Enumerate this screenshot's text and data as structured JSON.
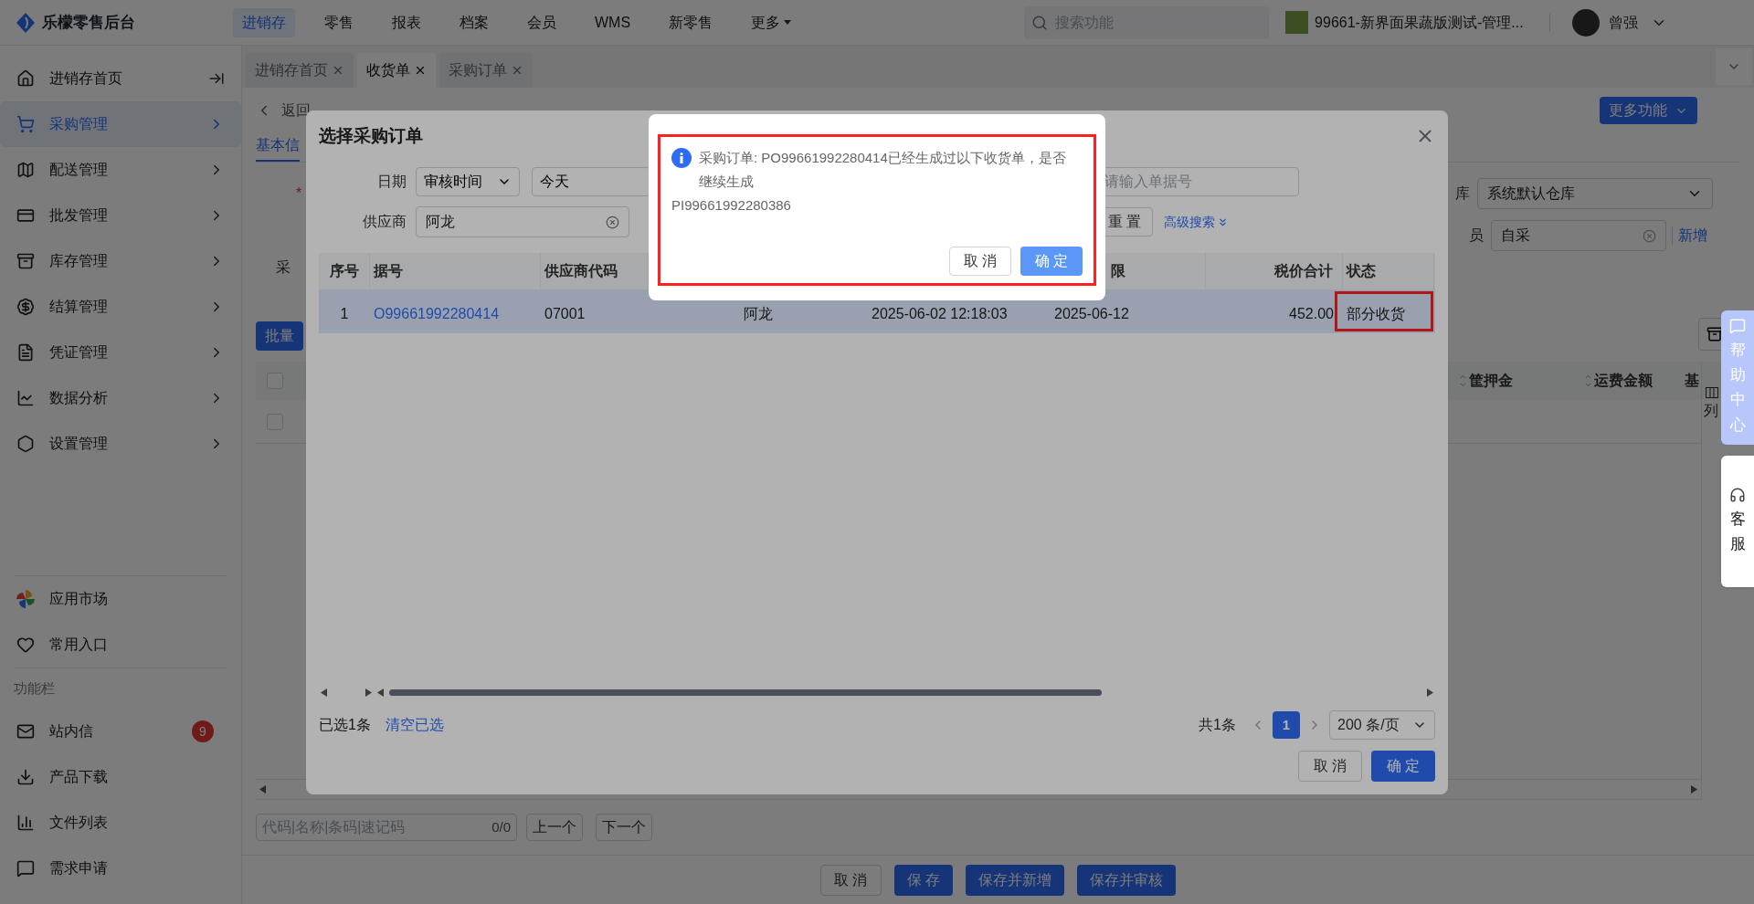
{
  "top_bar": {
    "logo": "乐檬零售后台",
    "nav": [
      {
        "label": "进销存",
        "selected": true,
        "kind": "link"
      },
      {
        "label": "零售",
        "selected": false,
        "kind": "link"
      },
      {
        "label": "报表",
        "selected": false,
        "kind": "link"
      },
      {
        "label": "档案",
        "selected": false,
        "kind": "link"
      },
      {
        "label": "会员",
        "selected": false,
        "kind": "link"
      },
      {
        "label": "WMS",
        "selected": false,
        "kind": "link"
      },
      {
        "label": "新零售",
        "selected": false,
        "kind": "link"
      },
      {
        "label": "更多",
        "selected": false,
        "kind": "dropdown"
      }
    ],
    "search": {
      "placeholder": "搜索功能"
    },
    "store": "99661-新界面果蔬版测试-管理...",
    "user": "曾强"
  },
  "sidebar": {
    "items": [
      {
        "label": "进销存首页",
        "selected": false
      },
      {
        "label": "采购管理",
        "selected": true
      },
      {
        "label": "配送管理",
        "selected": false
      },
      {
        "label": "批发管理",
        "selected": false
      },
      {
        "label": "库存管理",
        "selected": false
      },
      {
        "label": "结算管理",
        "selected": false
      },
      {
        "label": "凭证管理",
        "selected": false
      },
      {
        "label": "数据分析",
        "selected": false
      },
      {
        "label": "设置管理",
        "selected": false
      }
    ],
    "shortcuts": [
      {
        "label": "应用市场"
      },
      {
        "label": "常用入口"
      }
    ],
    "section_title": "功能栏",
    "tools": [
      {
        "label": "站内信",
        "badge": "9"
      },
      {
        "label": "产品下载"
      },
      {
        "label": "文件列表"
      },
      {
        "label": "需求申请"
      }
    ]
  },
  "page_tabs": [
    {
      "label": "进销存首页",
      "selected": false
    },
    {
      "label": "收货单",
      "selected": true
    },
    {
      "label": "采购订单",
      "selected": false
    }
  ],
  "page": {
    "back": "返回",
    "more_button": "更多功能",
    "form_tab": "基本信",
    "required_mark": "*",
    "label_fragment": "采",
    "warehouse": {
      "label": "库",
      "value": "系统默认仓库"
    },
    "buyer": {
      "label": "员",
      "value": "自采",
      "link": "新增"
    },
    "batch_button": "批量",
    "table": {
      "header_checked": false,
      "columns": [
        "筐押金",
        "运费金额",
        "基"
      ],
      "column_setting": "列",
      "rows": [
        {
          "checked": false
        }
      ]
    },
    "search": {
      "placeholder": "代码|名称|条码|速记码"
    },
    "count": "0/0",
    "prev": "上一个",
    "next": "下一个",
    "footer_buttons": [
      {
        "label": "取 消",
        "kind": "plain"
      },
      {
        "label": "保 存",
        "kind": "primary"
      },
      {
        "label": "保存并新增",
        "kind": "primary"
      },
      {
        "label": "保存并审核",
        "kind": "primary"
      }
    ]
  },
  "help": {
    "help_center": "帮助中心",
    "service": "客服"
  },
  "modal": {
    "title": "选择采购订单",
    "date_label": "日期",
    "date_type": "审核时间",
    "date_range": "今天",
    "number": {
      "placeholder": "请输入单据号"
    },
    "supplier_label": "供应商",
    "supplier_value": "阿龙",
    "reset": "重 置",
    "advanced": "高级搜索",
    "columns": [
      {
        "label": "序号"
      },
      {
        "label": "据号"
      },
      {
        "label": "供应商代码"
      },
      {},
      {},
      {
        "label": "限"
      },
      {
        "label": "税价合计"
      },
      {
        "label": "状态"
      }
    ],
    "rows": [
      {
        "selected": true,
        "status_marked": true,
        "cells": [
          "1",
          "O99661992280414",
          "07001",
          "阿龙",
          "2025-06-02 12:18:03",
          "2025-06-12",
          "452.00",
          "部分收货"
        ]
      }
    ],
    "selected_count": "已选1条",
    "clear": "清空已选",
    "total": "共1条",
    "pages": [
      {
        "label": "1",
        "selected": true
      }
    ],
    "page_size": "200 条/页",
    "cancel": "取 消",
    "ok": "确 定"
  },
  "confirm": {
    "marked": true,
    "message": "采购订单: PO99661992280414已经生成过以下收货单，是否继续生成",
    "order": "PI99661992280386",
    "cancel": "取 消",
    "ok": "确 定"
  }
}
